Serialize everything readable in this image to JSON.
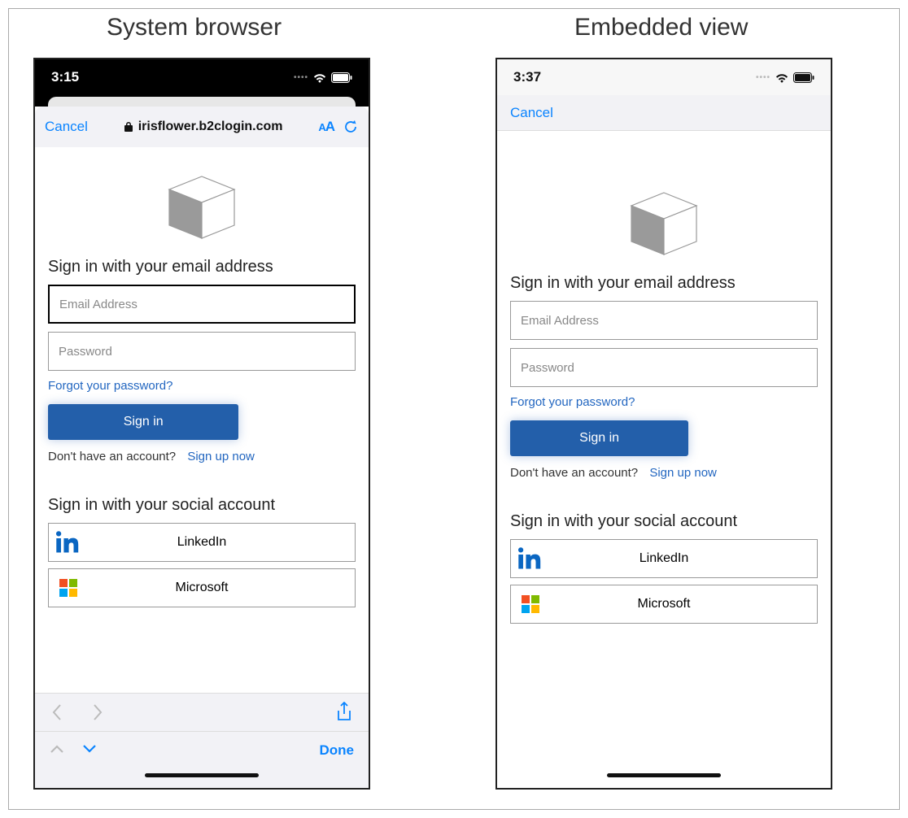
{
  "titles": {
    "left": "System browser",
    "right": "Embedded view"
  },
  "status": {
    "time_a": "3:15",
    "time_b": "3:37"
  },
  "browser_bar": {
    "cancel": "Cancel",
    "domain": "irisflower.b2clogin.com",
    "aa_small": "A",
    "aa_large": "A"
  },
  "embedded_nav": {
    "cancel": "Cancel"
  },
  "signin": {
    "heading": "Sign in with your email address",
    "email_placeholder": "Email Address",
    "password_placeholder": "Password",
    "forgot": "Forgot your password?",
    "button": "Sign in",
    "no_account": "Don't have an account?",
    "signup": "Sign up now"
  },
  "social": {
    "heading": "Sign in with your social account",
    "linkedin": "LinkedIn",
    "microsoft": "Microsoft"
  },
  "safari": {
    "done": "Done"
  }
}
